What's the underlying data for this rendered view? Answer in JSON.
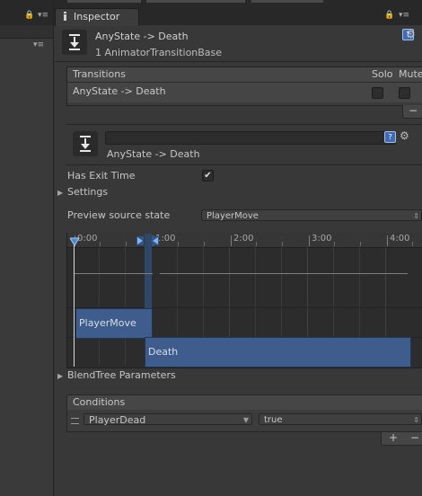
{
  "inspector": {
    "tab_label": "Inspector",
    "header_title": "AnyState -> Death",
    "header_subtitle": "1 AnimatorTransitionBase",
    "help_glyph": "?",
    "icon": "transition-icon"
  },
  "transitions": {
    "header_label": "Transitions",
    "solo_label": "Solo",
    "mute_label": "Mute",
    "rows": [
      {
        "name": "AnyState -> Death",
        "solo": false,
        "mute": false
      }
    ],
    "remove_glyph": "−"
  },
  "transition_detail": {
    "name_value": "",
    "subtitle": "AnyState -> Death",
    "help_glyph": "?",
    "gear_glyph": "⚙"
  },
  "properties": {
    "has_exit_time_label": "Has Exit Time",
    "has_exit_time": true,
    "checkmark_glyph": "✔",
    "settings_label": "Settings",
    "preview_label": "Preview source state",
    "preview_value": "PlayerMove"
  },
  "timeline": {
    "ticks": [
      "0:00",
      "1:00",
      "2:00",
      "3:00",
      "4:00"
    ],
    "source_state": "PlayerMove",
    "destination_state": "Death"
  },
  "blendtree_label": "BlendTree Parameters",
  "conditions": {
    "header_label": "Conditions",
    "rows": [
      {
        "parameter": "PlayerDead",
        "value": "true"
      }
    ],
    "add_glyph": "+",
    "remove_glyph": "−"
  },
  "colors": {
    "background": "#383838",
    "accent_blue": "#3e5d8c",
    "field_dark": "#2c2c2c"
  }
}
